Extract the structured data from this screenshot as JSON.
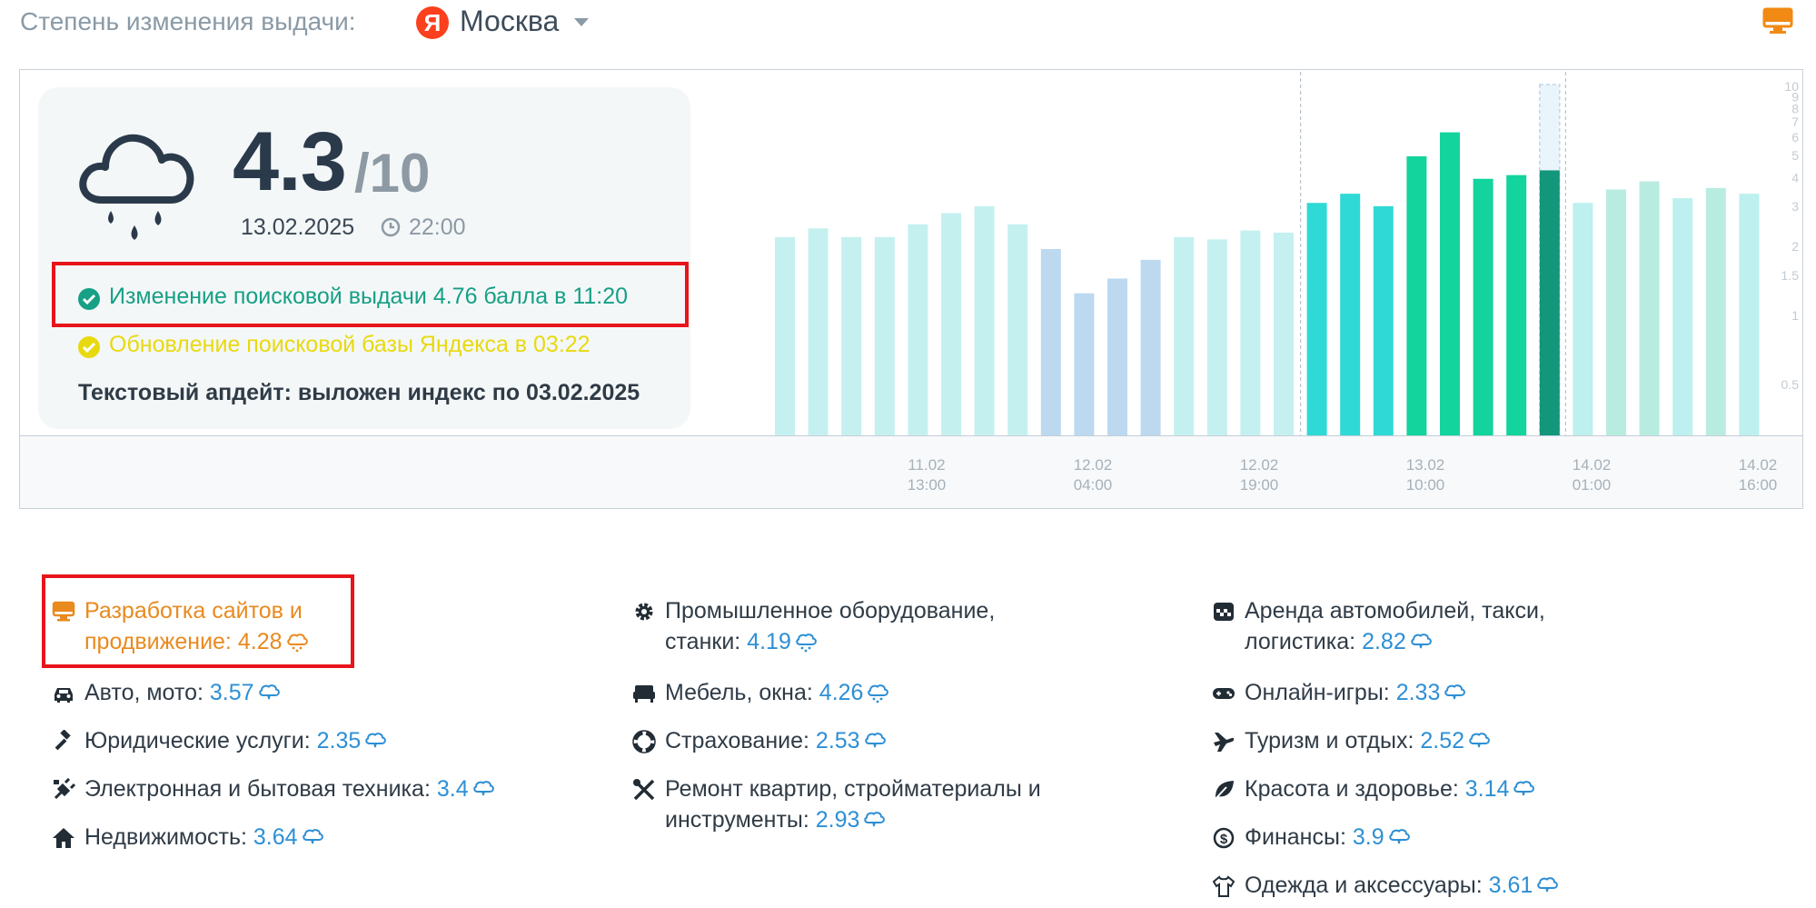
{
  "header": {
    "label": "Степень изменения выдачи:",
    "logo_letter": "Я",
    "city": "Москва",
    "accent": "#fc3f1d"
  },
  "weather": {
    "icon": "rain-cloud-icon",
    "score": "4.3",
    "score_max": "/10",
    "date": "13.02.2025",
    "time": "22:00"
  },
  "notices": {
    "change": "Изменение поисковой выдачи 4.76 балла в 11:20",
    "base_update": "Обновление поисковой базы Яндекса в 03:22",
    "text_update": "Текстовый апдейт: выложен индекс по 03.02.2025",
    "colors": {
      "change": "#16a085",
      "base_update": "#e8d90f"
    }
  },
  "chart_data": {
    "type": "bar",
    "title": "",
    "y_scale": "log",
    "ylim": [
      0.3,
      10
    ],
    "y_ticks": [
      "10",
      "9",
      "8",
      "7",
      "6",
      "5",
      "4",
      "3",
      "2",
      "1.5",
      "1",
      "0.5"
    ],
    "x_tick_labels": [
      [
        "11.02",
        "13:00"
      ],
      [
        "12.02",
        "04:00"
      ],
      [
        "12.02",
        "19:00"
      ],
      [
        "13.02",
        "10:00"
      ],
      [
        "14.02",
        "01:00"
      ],
      [
        "14.02",
        "16:00"
      ]
    ],
    "values": [
      2.2,
      2.4,
      2.2,
      2.2,
      2.5,
      2.8,
      3.0,
      2.5,
      1.95,
      1.25,
      1.45,
      1.75,
      2.2,
      2.15,
      2.35,
      2.3,
      3.1,
      3.4,
      3.0,
      4.95,
      6.3,
      3.95,
      4.1,
      4.3,
      3.1,
      3.55,
      3.85,
      3.25,
      3.6,
      3.4
    ],
    "highlight_range": [
      16,
      23
    ],
    "selected_index": 23
  },
  "categories": [
    {
      "icon": "monitor-icon",
      "name": "Разработка сайтов и",
      "name2": "продвижение:",
      "value": "4.28",
      "weather_icon": "rain-cloud-icon",
      "highlight": true
    },
    {
      "icon": "car-icon",
      "name": "Авто, мото:",
      "value": "3.57",
      "weather_icon": "cloud-icon"
    },
    {
      "icon": "gavel-icon",
      "name": "Юридические услуги:",
      "value": "2.35",
      "weather_icon": "cloud-icon"
    },
    {
      "icon": "plug-icon",
      "name": "Электронная и бытовая техника:",
      "value": "3.4",
      "weather_icon": "cloud-icon"
    },
    {
      "icon": "home-icon",
      "name": "Недвижимость:",
      "value": "3.64",
      "weather_icon": "cloud-icon"
    },
    {
      "icon": "gear-icon",
      "name": "Промышленное оборудование,",
      "name2": "станки:",
      "value": "4.19",
      "weather_icon": "rain-cloud-icon"
    },
    {
      "icon": "sofa-icon",
      "name": "Мебель, окна:",
      "value": "4.26",
      "weather_icon": "rain-cloud-icon"
    },
    {
      "icon": "lifebuoy-icon",
      "name": "Страхование:",
      "value": "2.53",
      "weather_icon": "cloud-icon"
    },
    {
      "icon": "tools-icon",
      "name": "Ремонт квартир, стройматериалы и",
      "name2": "инструменты:",
      "value": "2.93",
      "weather_icon": "cloud-icon"
    },
    {
      "icon": "taxi-icon",
      "name": "Аренда автомобилей, такси,",
      "name2": "логистика:",
      "value": "2.82",
      "weather_icon": "cloud-icon"
    },
    {
      "icon": "gamepad-icon",
      "name": "Онлайн-игры:",
      "value": "2.33",
      "weather_icon": "cloud-icon"
    },
    {
      "icon": "plane-icon",
      "name": "Туризм и отдых:",
      "value": "2.52",
      "weather_icon": "cloud-icon"
    },
    {
      "icon": "leaf-icon",
      "name": "Красота и здоровье:",
      "value": "3.14",
      "weather_icon": "cloud-icon"
    },
    {
      "icon": "dollar-icon",
      "name": "Финансы:",
      "value": "3.9",
      "weather_icon": "cloud-icon"
    },
    {
      "icon": "shirt-icon",
      "name": "Одежда и аксессуары:",
      "value": "3.61",
      "weather_icon": "cloud-icon"
    }
  ]
}
